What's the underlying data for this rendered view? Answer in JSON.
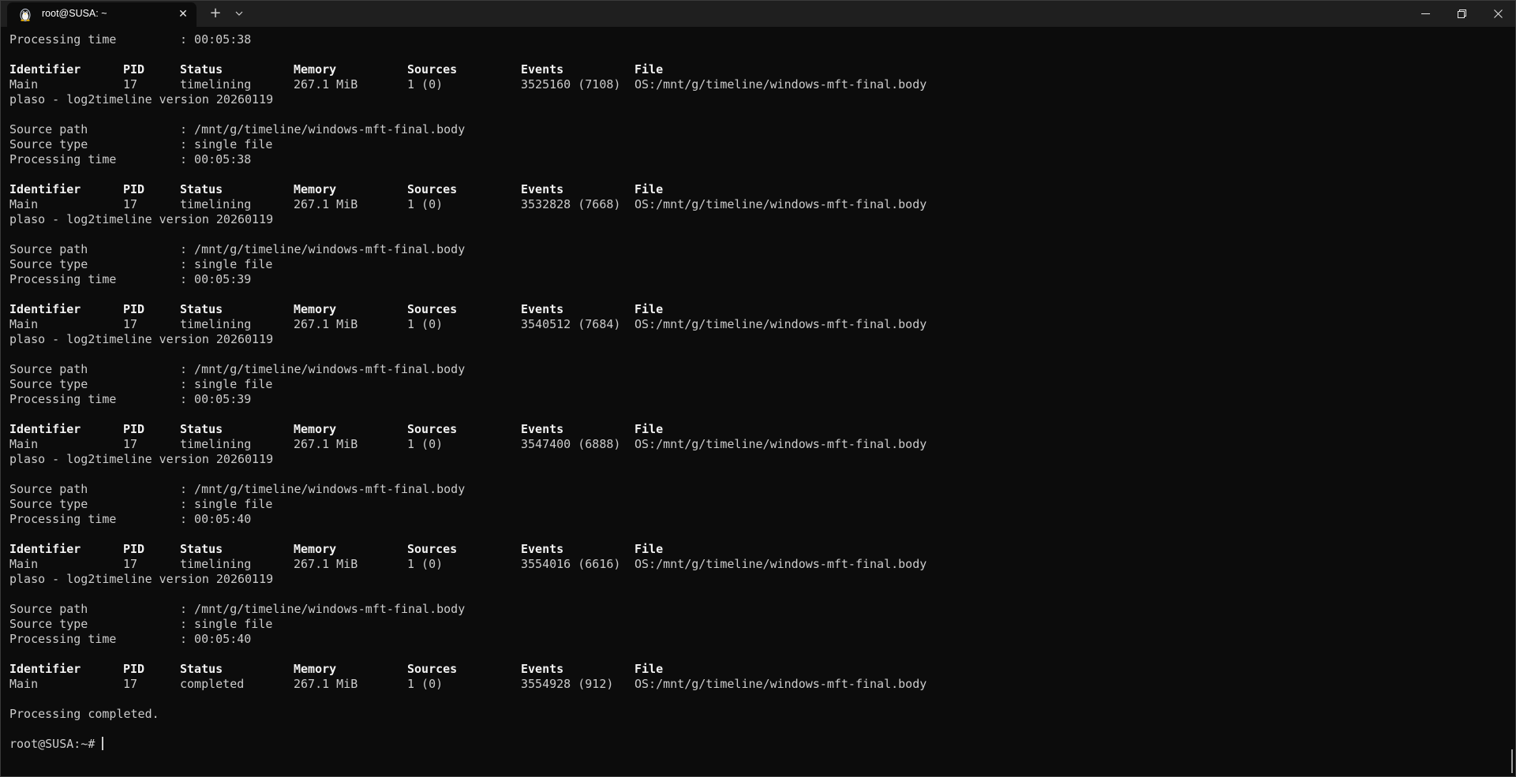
{
  "window": {
    "tab_title": "root@SUSA: ~",
    "tab_icon": "linux-penguin-icon",
    "new_tab_glyph": "+",
    "dropdown_glyph": "⌄",
    "close_tab_glyph": "✕",
    "minimize_glyph": "—",
    "close_glyph": "✕"
  },
  "terminal": {
    "first_line": {
      "label": "Processing time",
      "value": ": 00:05:38"
    },
    "headers": [
      "Identifier",
      "PID",
      "Status",
      "Memory",
      "Sources",
      "Events",
      "File"
    ],
    "version_line": "plaso - log2timeline version 20260119",
    "blocks": [
      {
        "row": [
          "Main",
          "17",
          "timelining",
          "267.1 MiB",
          "1 (0)",
          "3525160 (7108)",
          "OS:/mnt/g/timeline/windows-mft-final.body"
        ],
        "source_path": ": /mnt/g/timeline/windows-mft-final.body",
        "source_type": ": single file",
        "processing_time": ": 00:05:38"
      },
      {
        "row": [
          "Main",
          "17",
          "timelining",
          "267.1 MiB",
          "1 (0)",
          "3532828 (7668)",
          "OS:/mnt/g/timeline/windows-mft-final.body"
        ],
        "source_path": ": /mnt/g/timeline/windows-mft-final.body",
        "source_type": ": single file",
        "processing_time": ": 00:05:39"
      },
      {
        "row": [
          "Main",
          "17",
          "timelining",
          "267.1 MiB",
          "1 (0)",
          "3540512 (7684)",
          "OS:/mnt/g/timeline/windows-mft-final.body"
        ],
        "source_path": ": /mnt/g/timeline/windows-mft-final.body",
        "source_type": ": single file",
        "processing_time": ": 00:05:39"
      },
      {
        "row": [
          "Main",
          "17",
          "timelining",
          "267.1 MiB",
          "1 (0)",
          "3547400 (6888)",
          "OS:/mnt/g/timeline/windows-mft-final.body"
        ],
        "source_path": ": /mnt/g/timeline/windows-mft-final.body",
        "source_type": ": single file",
        "processing_time": ": 00:05:40"
      },
      {
        "row": [
          "Main",
          "17",
          "timelining",
          "267.1 MiB",
          "1 (0)",
          "3554016 (6616)",
          "OS:/mnt/g/timeline/windows-mft-final.body"
        ],
        "source_path": ": /mnt/g/timeline/windows-mft-final.body",
        "source_type": ": single file",
        "processing_time": ": 00:05:40"
      }
    ],
    "labels": {
      "source_path": "Source path",
      "source_type": "Source type",
      "processing_time": "Processing time"
    },
    "final_row": [
      "Main",
      "17",
      "completed",
      "267.1 MiB",
      "1 (0)",
      "3554928 (912)",
      "OS:/mnt/g/timeline/windows-mft-final.body"
    ],
    "completed_message": "Processing completed.",
    "prompt": "root@SUSA:~#"
  },
  "colors": {
    "background": "#0c0c0c",
    "titlebar": "#1f1f1f",
    "text": "#cccccc",
    "header_text": "#f2f2f2"
  }
}
